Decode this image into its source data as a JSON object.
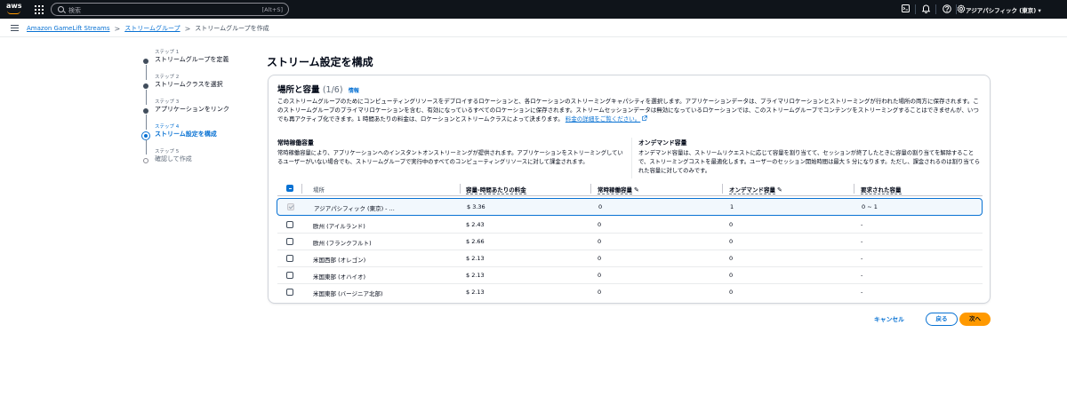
{
  "topnav": {
    "logo_text": "aws",
    "search_placeholder": "検索",
    "search_shortcut": "[Alt+S]",
    "region": "アジアパシフィック (東京) ▾"
  },
  "breadcrumb": {
    "items": [
      "Amazon GameLift Streams",
      "ストリームグループ"
    ],
    "current": "ストリームグループを作成",
    "separator": ">"
  },
  "steps": [
    {
      "num": "ステップ 1",
      "label": "ストリームグループを定義"
    },
    {
      "num": "ステップ 2",
      "label": "ストリームクラスを選択"
    },
    {
      "num": "ステップ 3",
      "label": "アプリケーションをリンク"
    },
    {
      "num": "ステップ 4",
      "label": "ストリーム設定を構成"
    },
    {
      "num": "ステップ 5",
      "label": "確認して作成"
    }
  ],
  "page_title": "ストリーム設定を構成",
  "panel": {
    "title": "場所と容量",
    "count": "(1/6)",
    "info": "情報",
    "description": "このストリームグループのためにコンピューティングリソースをデプロイするロケーションと、各ロケーションのストリーミングキャパシティを選択します。アプリケーションデータは、プライマリロケーションとストリーミングが行われた場所の両方に保存されます。このストリームグループのプライマリロケーションを含む、有効になっているすべてのロケーションに保存されます。ストリームセッションデータは無効になっているロケーションでは、このストリームグループでコンテンツをストリーミングすることはできませんが、いつでも再アクティブ化できます。1 時間あたりの料金は、ロケーションとストリームクラスによって決まります。",
    "pricing_link": "料金の詳細をご覧ください。",
    "always_on": {
      "title": "常時稼働容量",
      "text": "常時稼働容量により、アプリケーションへのインスタントオンストリーミングが提供されます。アプリケーションをストリーミングしているユーザーがいない場合でも、ストリームグループで実行中のすべてのコンピューティングリソースに対して課金されます。"
    },
    "on_demand": {
      "title": "オンデマンド容量",
      "text": "オンデマンド容量は、ストリームリクエストに応じて容量を割り当てて、セッションが終了したときに容量の割り当てを解除することで、ストリーミングコストを最適化します。ユーザーのセッション開始時間は最大 5 分になります。ただし、課金されるのは割り当てられた容量に対してのみです。"
    }
  },
  "table": {
    "headers": {
      "location": "場所",
      "price": "容量-時間あたりの料金",
      "always_on": "常時稼働容量",
      "on_demand": "オンデマンド容量",
      "requested": "要求された容量"
    },
    "rows": [
      {
        "location": "アジアパシフィック (東京) - ...",
        "price": "$ 3.36",
        "always_on": "0",
        "on_demand": "1",
        "requested": "0 ~ 1",
        "selected": true
      },
      {
        "location": "欧州 (アイルランド)",
        "price": "$ 2.43",
        "always_on": "0",
        "on_demand": "0",
        "requested": "-",
        "selected": false
      },
      {
        "location": "欧州 (フランクフルト)",
        "price": "$ 2.66",
        "always_on": "0",
        "on_demand": "0",
        "requested": "-",
        "selected": false
      },
      {
        "location": "米国西部 (オレゴン)",
        "price": "$ 2.13",
        "always_on": "0",
        "on_demand": "0",
        "requested": "-",
        "selected": false
      },
      {
        "location": "米国東部 (オハイオ)",
        "price": "$ 2.13",
        "always_on": "0",
        "on_demand": "0",
        "requested": "-",
        "selected": false
      },
      {
        "location": "米国東部 (バージニア北部)",
        "price": "$ 2.13",
        "always_on": "0",
        "on_demand": "0",
        "requested": "-",
        "selected": false
      }
    ]
  },
  "footer": {
    "cancel": "キャンセル",
    "back": "戻る",
    "next": "次へ"
  },
  "colors": {
    "accent": "#0972d3",
    "primary_button": "#ff9900",
    "nav_background": "#0f141a"
  }
}
